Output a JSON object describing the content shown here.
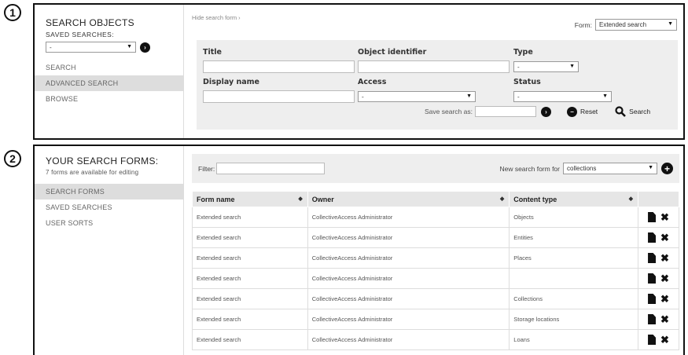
{
  "markers": [
    "1",
    "2"
  ],
  "panel1": {
    "sidebar": {
      "title": "SEARCH OBJECTS",
      "saved_label": "SAVED SEARCHES:",
      "saved_value": "-",
      "items": [
        {
          "label": "SEARCH",
          "active": false
        },
        {
          "label": "ADVANCED SEARCH",
          "active": true
        },
        {
          "label": "BROWSE",
          "active": false
        }
      ]
    },
    "hide_link": "Hide search form ›",
    "form_label": "Form:",
    "form_value": "Extended search",
    "fields": {
      "title": "Title",
      "object_identifier": "Object identifier",
      "type": "Type",
      "type_value": "-",
      "display_name": "Display name",
      "access": "Access",
      "access_value": "-",
      "status": "Status",
      "status_value": "-"
    },
    "save_search_label": "Save search as:",
    "reset_label": "Reset",
    "search_label": "Search"
  },
  "panel2": {
    "sidebar": {
      "title": "YOUR SEARCH FORMS:",
      "subtitle": "7 forms are available for editing",
      "items": [
        {
          "label": "SEARCH FORMS",
          "active": true
        },
        {
          "label": "SAVED SEARCHES",
          "active": false
        },
        {
          "label": "USER SORTS",
          "active": false
        }
      ]
    },
    "filter_label": "Filter:",
    "new_form_label": "New search form for",
    "new_form_value": "collections",
    "columns": [
      "Form name",
      "Owner",
      "Content type"
    ],
    "rows": [
      {
        "name": "Extended search",
        "owner": "CollectiveAccess Administrator",
        "type": "Objects"
      },
      {
        "name": "Extended search",
        "owner": "CollectiveAccess Administrator",
        "type": "Entities"
      },
      {
        "name": "Extended search",
        "owner": "CollectiveAccess Administrator",
        "type": "Places"
      },
      {
        "name": "Extended search",
        "owner": "CollectiveAccess Administrator",
        "type": ""
      },
      {
        "name": "Extended search",
        "owner": "CollectiveAccess Administrator",
        "type": "Collections"
      },
      {
        "name": "Extended search",
        "owner": "CollectiveAccess Administrator",
        "type": "Storage locations"
      },
      {
        "name": "Extended search",
        "owner": "CollectiveAccess Administrator",
        "type": "Loans"
      }
    ]
  }
}
